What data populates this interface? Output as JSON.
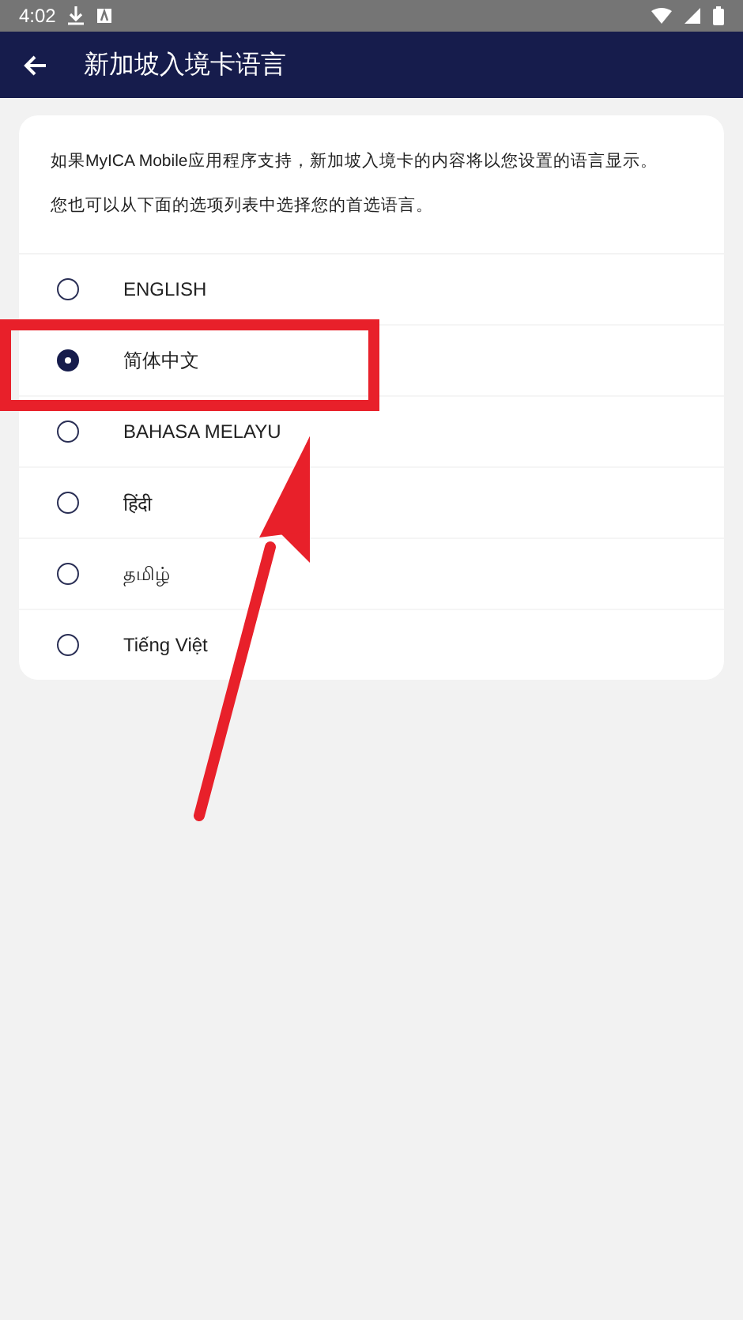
{
  "status_bar": {
    "time": "4:02"
  },
  "header": {
    "title": "新加坡入境卡语言"
  },
  "intro": [
    "如果MyICA Mobile应用程序支持，新加坡入境卡的内容将以您设置的语言显示。",
    "您也可以从下面的选项列表中选择您的首选语言。"
  ],
  "languages": [
    {
      "label": "ENGLISH",
      "selected": false
    },
    {
      "label": "简体中文",
      "selected": true
    },
    {
      "label": "BAHASA MELAYU",
      "selected": false
    },
    {
      "label": "हिंदी",
      "selected": false
    },
    {
      "label": "தமிழ்",
      "selected": false
    },
    {
      "label": "Tiếng Việt",
      "selected": false
    }
  ]
}
